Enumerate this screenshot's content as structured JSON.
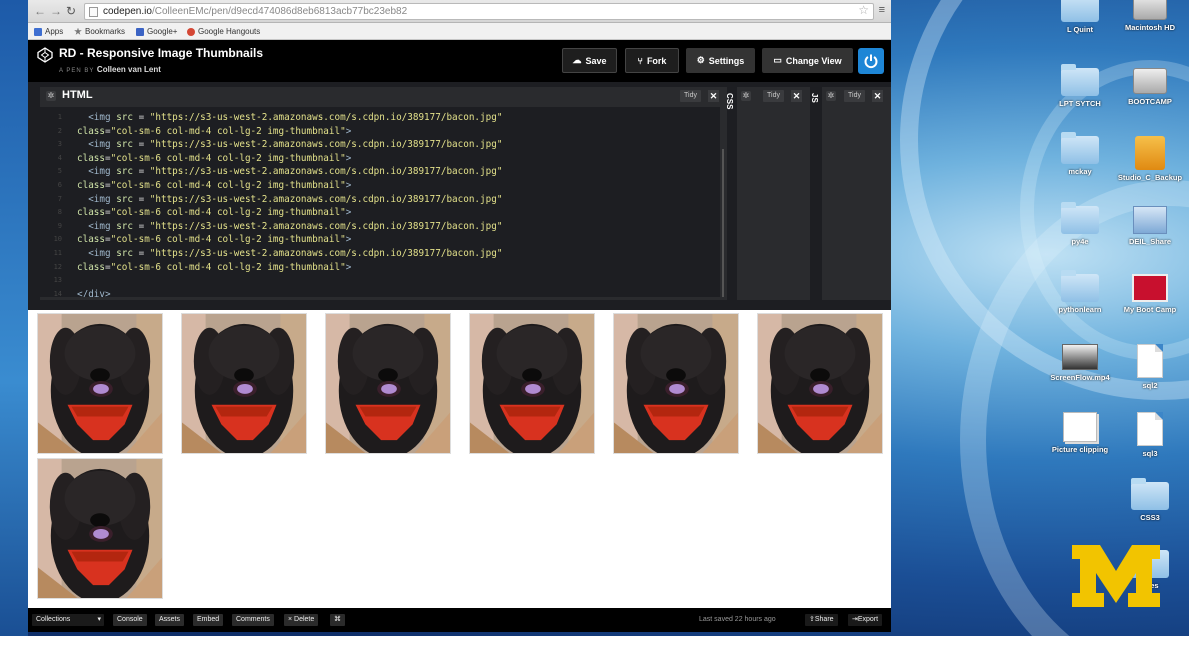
{
  "browser": {
    "url_host": "codepen.io",
    "url_path": "/ColleenEMc/pen/d9ecd474086d8eb6813acb77bc23eb82",
    "bookmarks": [
      {
        "label": "Apps",
        "color": "#3f6fd1"
      },
      {
        "label": "Bookmarks",
        "color": "#777777"
      },
      {
        "label": "Google+",
        "color": "#3b63c4"
      },
      {
        "label": "Google Hangouts",
        "color": "#d44735"
      }
    ]
  },
  "codepen": {
    "title": "RD - Responsive Image Thumbnails",
    "subtitle_prefix": "A PEN BY",
    "author": "Colleen van Lent",
    "buttons": {
      "save": "Save",
      "fork": "Fork",
      "settings": "Settings",
      "change_view": "Change View"
    },
    "accent": "#1e86d6"
  },
  "editor": {
    "html_label": "HTML",
    "css_label": "CSS",
    "js_label": "JS",
    "tidy": "Tidy",
    "close": "✕",
    "lines": [
      {
        "indent": "  ",
        "parts": [
          [
            "tag",
            "<img "
          ],
          [
            "attr",
            "src"
          ],
          [
            "txt",
            " = "
          ],
          [
            "str",
            "\"https://s3-us-west-2.amazonaws.com/s.cdpn.io/389177/bacon.jpg\""
          ]
        ]
      },
      {
        "indent": "",
        "parts": [
          [
            "attr",
            "class"
          ],
          [
            "txt",
            "="
          ],
          [
            "str",
            "\"col-sm-6 col-md-4 col-lg-2 img-thumbnail\""
          ],
          [
            "tag",
            ">"
          ]
        ]
      },
      {
        "indent": "  ",
        "parts": [
          [
            "tag",
            "<img "
          ],
          [
            "attr",
            "src"
          ],
          [
            "txt",
            " = "
          ],
          [
            "str",
            "\"https://s3-us-west-2.amazonaws.com/s.cdpn.io/389177/bacon.jpg\""
          ]
        ]
      },
      {
        "indent": "",
        "parts": [
          [
            "attr",
            "class"
          ],
          [
            "txt",
            "="
          ],
          [
            "str",
            "\"col-sm-6 col-md-4 col-lg-2 img-thumbnail\""
          ],
          [
            "tag",
            ">"
          ]
        ]
      },
      {
        "indent": "  ",
        "parts": [
          [
            "tag",
            "<img "
          ],
          [
            "attr",
            "src"
          ],
          [
            "txt",
            " = "
          ],
          [
            "str",
            "\"https://s3-us-west-2.amazonaws.com/s.cdpn.io/389177/bacon.jpg\""
          ]
        ]
      },
      {
        "indent": "",
        "parts": [
          [
            "attr",
            "class"
          ],
          [
            "txt",
            "="
          ],
          [
            "str",
            "\"col-sm-6 col-md-4 col-lg-2 img-thumbnail\""
          ],
          [
            "tag",
            ">"
          ]
        ]
      },
      {
        "indent": "  ",
        "parts": [
          [
            "tag",
            "<img "
          ],
          [
            "attr",
            "src"
          ],
          [
            "txt",
            " = "
          ],
          [
            "str",
            "\"https://s3-us-west-2.amazonaws.com/s.cdpn.io/389177/bacon.jpg\""
          ]
        ]
      },
      {
        "indent": "",
        "parts": [
          [
            "attr",
            "class"
          ],
          [
            "txt",
            "="
          ],
          [
            "str",
            "\"col-sm-6 col-md-4 col-lg-2 img-thumbnail\""
          ],
          [
            "tag",
            ">"
          ]
        ]
      },
      {
        "indent": "  ",
        "parts": [
          [
            "tag",
            "<img "
          ],
          [
            "attr",
            "src"
          ],
          [
            "txt",
            " = "
          ],
          [
            "str",
            "\"https://s3-us-west-2.amazonaws.com/s.cdpn.io/389177/bacon.jpg\""
          ]
        ]
      },
      {
        "indent": "",
        "parts": [
          [
            "attr",
            "class"
          ],
          [
            "txt",
            "="
          ],
          [
            "str",
            "\"col-sm-6 col-md-4 col-lg-2 img-thumbnail\""
          ],
          [
            "tag",
            ">"
          ]
        ]
      },
      {
        "indent": "  ",
        "parts": [
          [
            "tag",
            "<img "
          ],
          [
            "attr",
            "src"
          ],
          [
            "txt",
            " = "
          ],
          [
            "str",
            "\"https://s3-us-west-2.amazonaws.com/s.cdpn.io/389177/bacon.jpg\""
          ]
        ]
      },
      {
        "indent": "",
        "parts": [
          [
            "attr",
            "class"
          ],
          [
            "txt",
            "="
          ],
          [
            "str",
            "\"col-sm-6 col-md-4 col-lg-2 img-thumbnail\""
          ],
          [
            "tag",
            ">"
          ]
        ]
      },
      {
        "indent": "",
        "parts": [
          [
            "txt",
            ""
          ]
        ]
      },
      {
        "indent": "",
        "parts": [
          [
            "tag",
            "</div>"
          ]
        ]
      }
    ]
  },
  "preview": {
    "thumbnail_count": 7,
    "image_subject": "black dog with red bandana"
  },
  "footer": {
    "collections": "Collections",
    "buttons": [
      "Console",
      "Assets",
      "Embed",
      "Comments",
      "× Delete",
      "⌘"
    ],
    "last_saved": "Last saved 22 hours ago",
    "share": "Share",
    "export": "Export"
  },
  "desktop": {
    "icons": [
      {
        "label": "L Quint",
        "type": "folder"
      },
      {
        "label": "Macintosh HD",
        "type": "drive"
      },
      {
        "label": "LPT SYTCH",
        "type": "folder"
      },
      {
        "label": "BOOTCAMP",
        "type": "drive"
      },
      {
        "label": "mckay",
        "type": "folder"
      },
      {
        "label": "Studio_C_Backup",
        "type": "usb"
      },
      {
        "label": "py4e",
        "type": "folder"
      },
      {
        "label": "DEIL_Share",
        "type": "share"
      },
      {
        "label": "pythonlearn",
        "type": "folder"
      },
      {
        "label": "My Boot Camp",
        "type": "parallels"
      },
      {
        "label": "ScreenFlow.mp4",
        "type": "video"
      },
      {
        "label": "sql2",
        "type": "doc"
      },
      {
        "label": "Picture clipping",
        "type": "clip"
      },
      {
        "label": "sql3",
        "type": "doc"
      },
      {
        "label": "CSS3",
        "type": "folder"
      },
      {
        "label": "Files",
        "type": "folder"
      }
    ],
    "logo_color": "#f2c400"
  }
}
